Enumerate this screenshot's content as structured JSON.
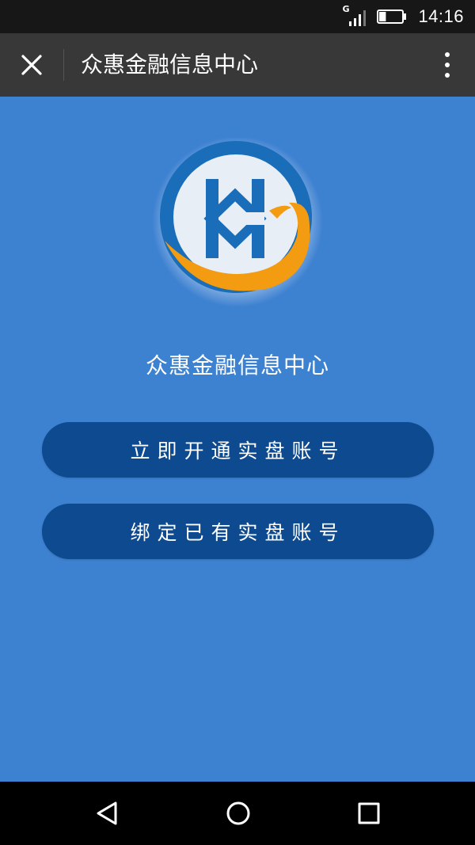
{
  "status_bar": {
    "network": "G",
    "time": "14:16",
    "battery_level": 0.3
  },
  "app_bar": {
    "title": "众惠金融信息中心"
  },
  "main": {
    "title": "众惠金融信息中心",
    "buttons": [
      {
        "label": "立即开通实盘账号"
      },
      {
        "label": "绑定已有实盘账号"
      }
    ]
  },
  "colors": {
    "background": "#3d81d1",
    "button": "#0d4a8f",
    "logo_blue": "#1a6db8",
    "logo_orange": "#f39c12"
  },
  "icons": {
    "close": "close-icon",
    "more": "more-vert-icon",
    "back": "back-triangle-icon",
    "home": "home-circle-icon",
    "recent": "recent-square-icon"
  }
}
